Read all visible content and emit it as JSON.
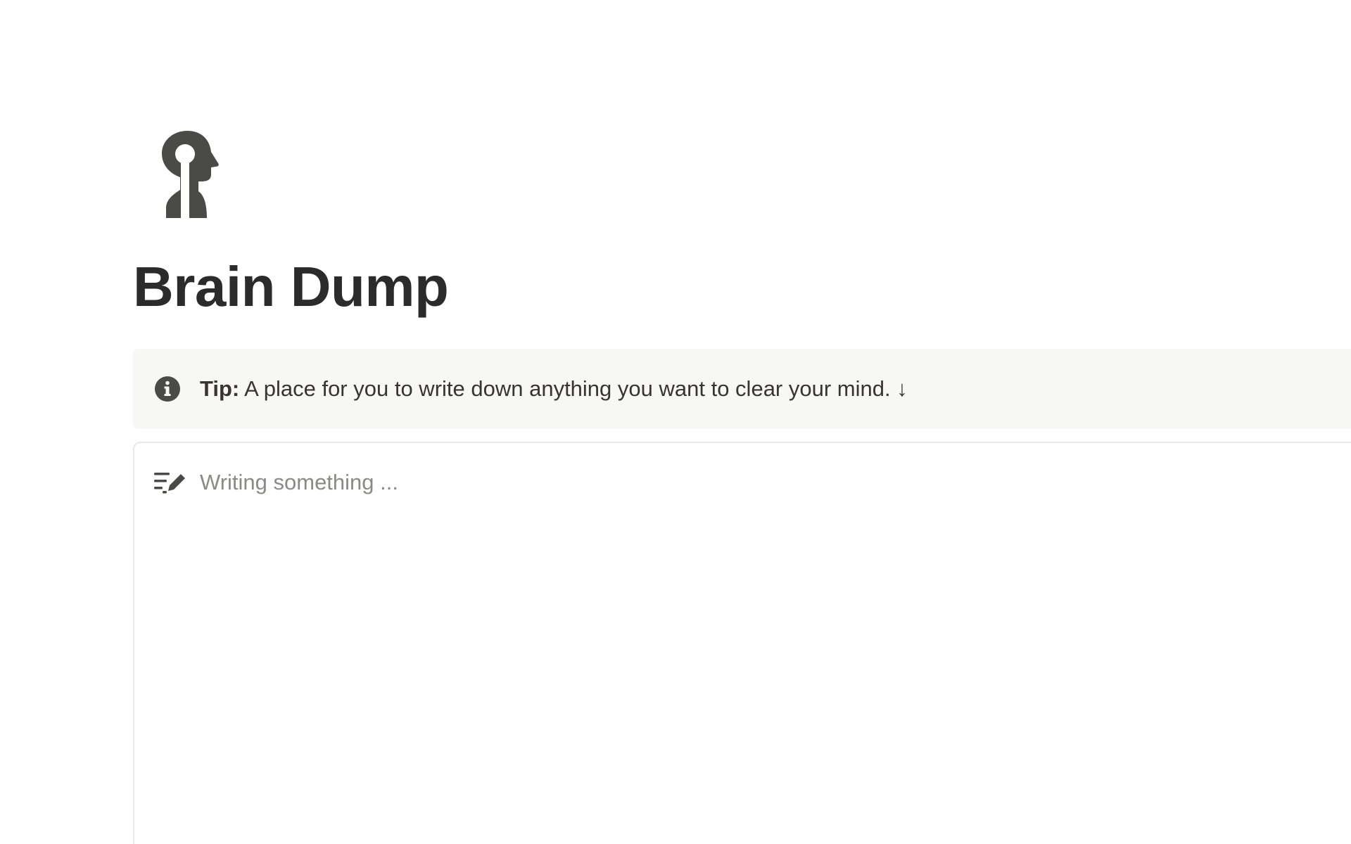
{
  "page": {
    "icon": "head-keyhole-icon",
    "title": "Brain Dump"
  },
  "callout": {
    "icon": "info-icon",
    "label": "Tip:",
    "text": " A place for you to write down anything you want to clear your mind. ↓"
  },
  "editor": {
    "icon": "write-notes-icon",
    "value": "",
    "placeholder": "Writing something ..."
  },
  "colors": {
    "text": "#37352f",
    "icon": "#4a4a47",
    "callout_bg": "#f7f7f5",
    "border": "#e9e9e7",
    "placeholder": "#8a8a86"
  }
}
